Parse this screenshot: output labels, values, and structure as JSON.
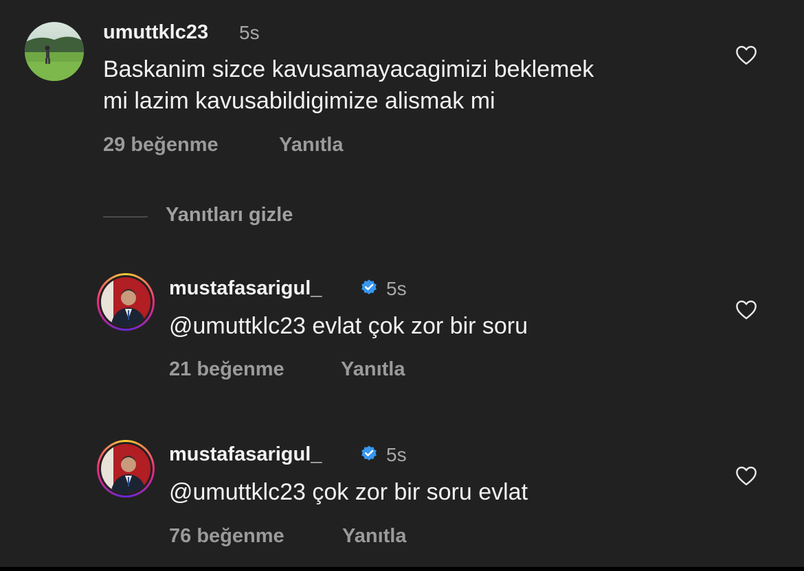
{
  "comments": [
    {
      "username": "umuttklc23",
      "time": "5s",
      "text_line1": "Baskanim sizce kavusamayacagimizi beklemek",
      "text_line2": "mi lazim kavusabildigimize alismak mi",
      "likes": "29 beğenme",
      "reply_label": "Yanıtla",
      "verified": false
    }
  ],
  "replies_toggle": "Yanıtları gizle",
  "replies": [
    {
      "username": "mustafasarigul_",
      "time": "5s",
      "text": "@umuttklc23 evlat çok zor bir soru",
      "likes": "21 beğenme",
      "reply_label": "Yanıtla",
      "verified": true
    },
    {
      "username": "mustafasarigul_",
      "time": "5s",
      "text": "@umuttklc23 çok zor bir soru evlat",
      "likes": "76 beğenme",
      "reply_label": "Yanıtla",
      "verified": true
    }
  ],
  "colors": {
    "background": "#212121",
    "verified_badge": "#3897f0",
    "secondary_text": "#a8a8a8"
  },
  "icons": {
    "like": "heart-outline-icon",
    "verified": "verified-badge-icon"
  }
}
